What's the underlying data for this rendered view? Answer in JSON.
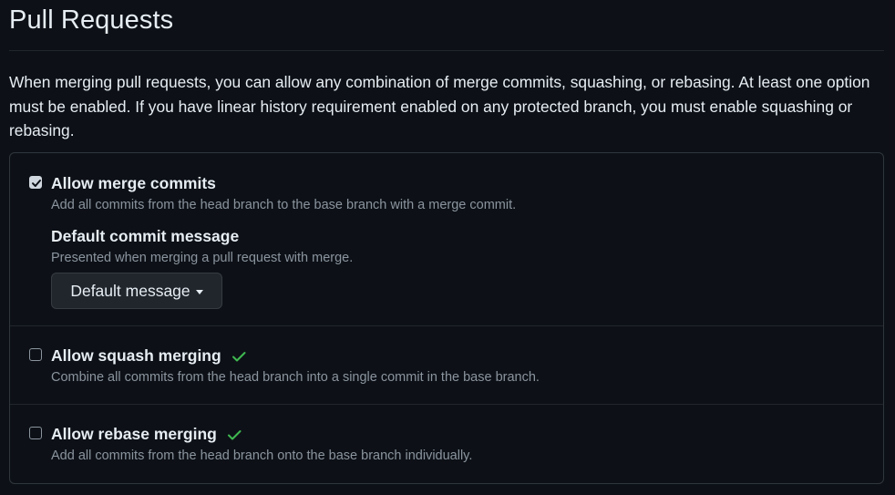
{
  "page": {
    "title": "Pull Requests",
    "description": "When merging pull requests, you can allow any combination of merge commits, squashing, or rebasing. At least one option must be enabled. If you have linear history requirement enabled on any protected branch, you must enable squashing or rebasing."
  },
  "options": {
    "merge": {
      "label": "Allow merge commits",
      "note": "Add all commits from the head branch to the base branch with a merge commit.",
      "checked": true,
      "default_commit": {
        "label": "Default commit message",
        "note": "Presented when merging a pull request with merge.",
        "dropdown_label": "Default message"
      }
    },
    "squash": {
      "label": "Allow squash merging",
      "note": "Combine all commits from the head branch into a single commit in the base branch.",
      "checked": false,
      "status_icon": "check-icon"
    },
    "rebase": {
      "label": "Allow rebase merging",
      "note": "Add all commits from the head branch onto the base branch individually.",
      "checked": false,
      "status_icon": "check-icon"
    }
  },
  "colors": {
    "background": "#0d1117",
    "border": "#30363d",
    "muted_text": "#8b949e",
    "success": "#3fb950",
    "button_bg": "#21262d"
  }
}
